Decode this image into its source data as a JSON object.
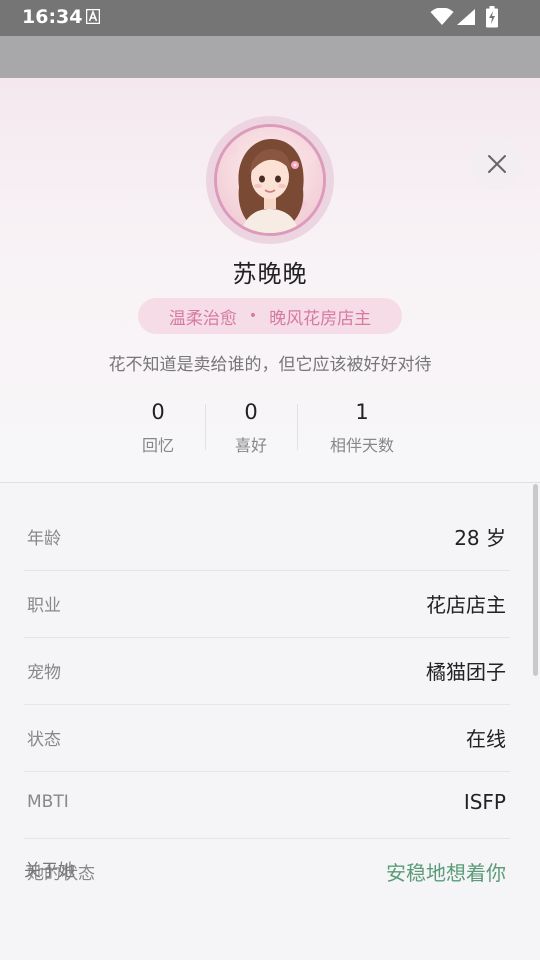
{
  "status_bar": {
    "time": "16:34"
  },
  "profile": {
    "name": "苏晚晚",
    "tag_left": "温柔治愈",
    "tag_dot": "•",
    "tag_right": "晚风花房店主",
    "quote": "花不知道是卖给谁的，但它应该被好好对待"
  },
  "stats": [
    {
      "value": "0",
      "label": "回忆"
    },
    {
      "value": "0",
      "label": "喜好"
    },
    {
      "value": "1",
      "label": "相伴天数"
    }
  ],
  "info_rows": [
    {
      "key": "年龄",
      "value": "28 岁"
    },
    {
      "key": "职业",
      "value": "花店店主"
    },
    {
      "key": "宠物",
      "value": "橘猫团子"
    },
    {
      "key": "状态",
      "value": "在线"
    },
    {
      "key": "MBTI",
      "value": "ISFP"
    },
    {
      "key": "她的状态",
      "value": "安稳地想着你"
    }
  ],
  "about_title": "关于她",
  "colors": {
    "accent_pink": "#d77aa2",
    "status_green": "#5a9c78"
  },
  "icons": [
    "app-a-icon",
    "wifi-icon",
    "signal-icon",
    "battery-charging-icon",
    "close-icon",
    "avatar"
  ]
}
